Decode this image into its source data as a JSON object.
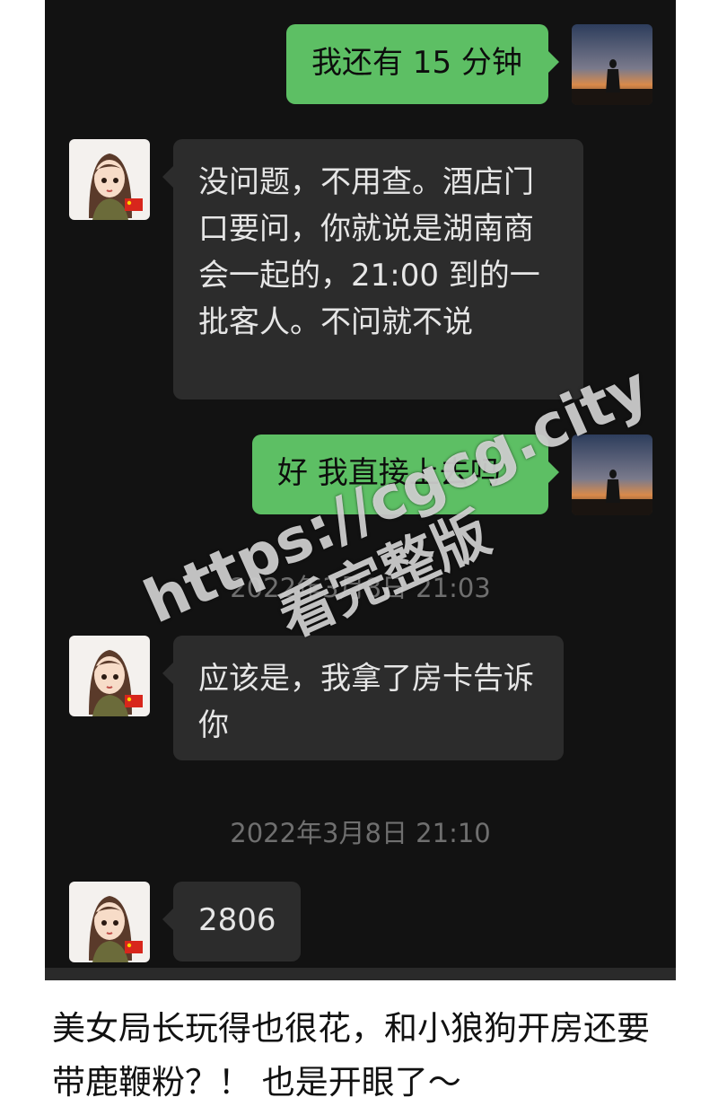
{
  "chat": {
    "messages": [
      {
        "sender": "me",
        "text": "我还有 15 分钟"
      },
      {
        "sender": "other",
        "text": "没问题，不用查。酒店门口要问，你就说是湖南商会一起的，21:00 到的一批客人。不问就不说"
      },
      {
        "sender": "me",
        "text": "好 我直接上去吗"
      },
      {
        "timestamp": "2022年3月8日 21:03"
      },
      {
        "sender": "other",
        "text": "应该是，我拿了房卡告诉你"
      },
      {
        "timestamp": "2022年3月8日 21:10"
      },
      {
        "sender": "other",
        "text": "2806"
      }
    ],
    "avatars": {
      "me": "sunset-silhouette-avatar",
      "other": "cartoon-woman-avatar"
    }
  },
  "watermark": {
    "url": "https://cgcg.city",
    "text": "看完整版"
  },
  "caption": {
    "text": "美女局长玩得也很花，和小狼狗开房还要带鹿鞭粉？！ 也是开眼了～"
  },
  "colors": {
    "chat_bg": "#121212",
    "bubble_out": "#5dbf64",
    "bubble_in": "#2c2c2c",
    "timestamp": "#6f6f6f"
  }
}
